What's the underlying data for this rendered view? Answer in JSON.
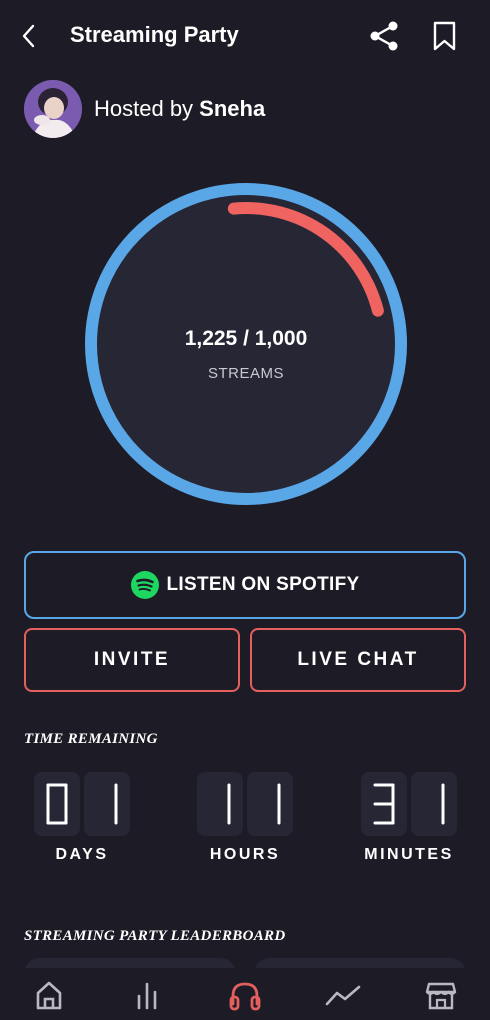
{
  "header": {
    "title": "Streaming Party",
    "back_icon": "back-chevron-icon",
    "share_icon": "share-icon",
    "bookmark_icon": "bookmark-icon"
  },
  "host": {
    "prefix": "Hosted by ",
    "name": "Sneha"
  },
  "progress": {
    "current": "1,225",
    "goal": "1,000",
    "display": "1,225 / 1,000",
    "label": "STREAMS",
    "ring_color": "#5aa7e8",
    "arc_color": "#ef6360",
    "arc_fraction": 0.225
  },
  "actions": {
    "spotify_label": "LISTEN ON SPOTIFY",
    "spotify_icon": "spotify-icon",
    "invite_label": "INVITE",
    "chat_label": "LIVE CHAT"
  },
  "time_remaining": {
    "title": "TIME REMAINING",
    "days": {
      "digits": [
        "0",
        "1"
      ],
      "label": "DAYS"
    },
    "hours": {
      "digits": [
        "1",
        "1"
      ],
      "label": "HOURS"
    },
    "minutes": {
      "digits": [
        "3",
        "1"
      ],
      "label": "MINUTES"
    }
  },
  "leaderboard": {
    "title": "STREAMING PARTY LEADERBOARD"
  },
  "nav": {
    "items": [
      {
        "icon": "home-icon",
        "active": false
      },
      {
        "icon": "chart-bars-icon",
        "active": false
      },
      {
        "icon": "headphones-icon",
        "active": true
      },
      {
        "icon": "trend-line-icon",
        "active": false
      },
      {
        "icon": "store-icon",
        "active": false
      }
    ]
  },
  "colors": {
    "background": "#1d1c26",
    "blue": "#5aa7e8",
    "red": "#e4605e",
    "spotify_green": "#1ed760"
  }
}
